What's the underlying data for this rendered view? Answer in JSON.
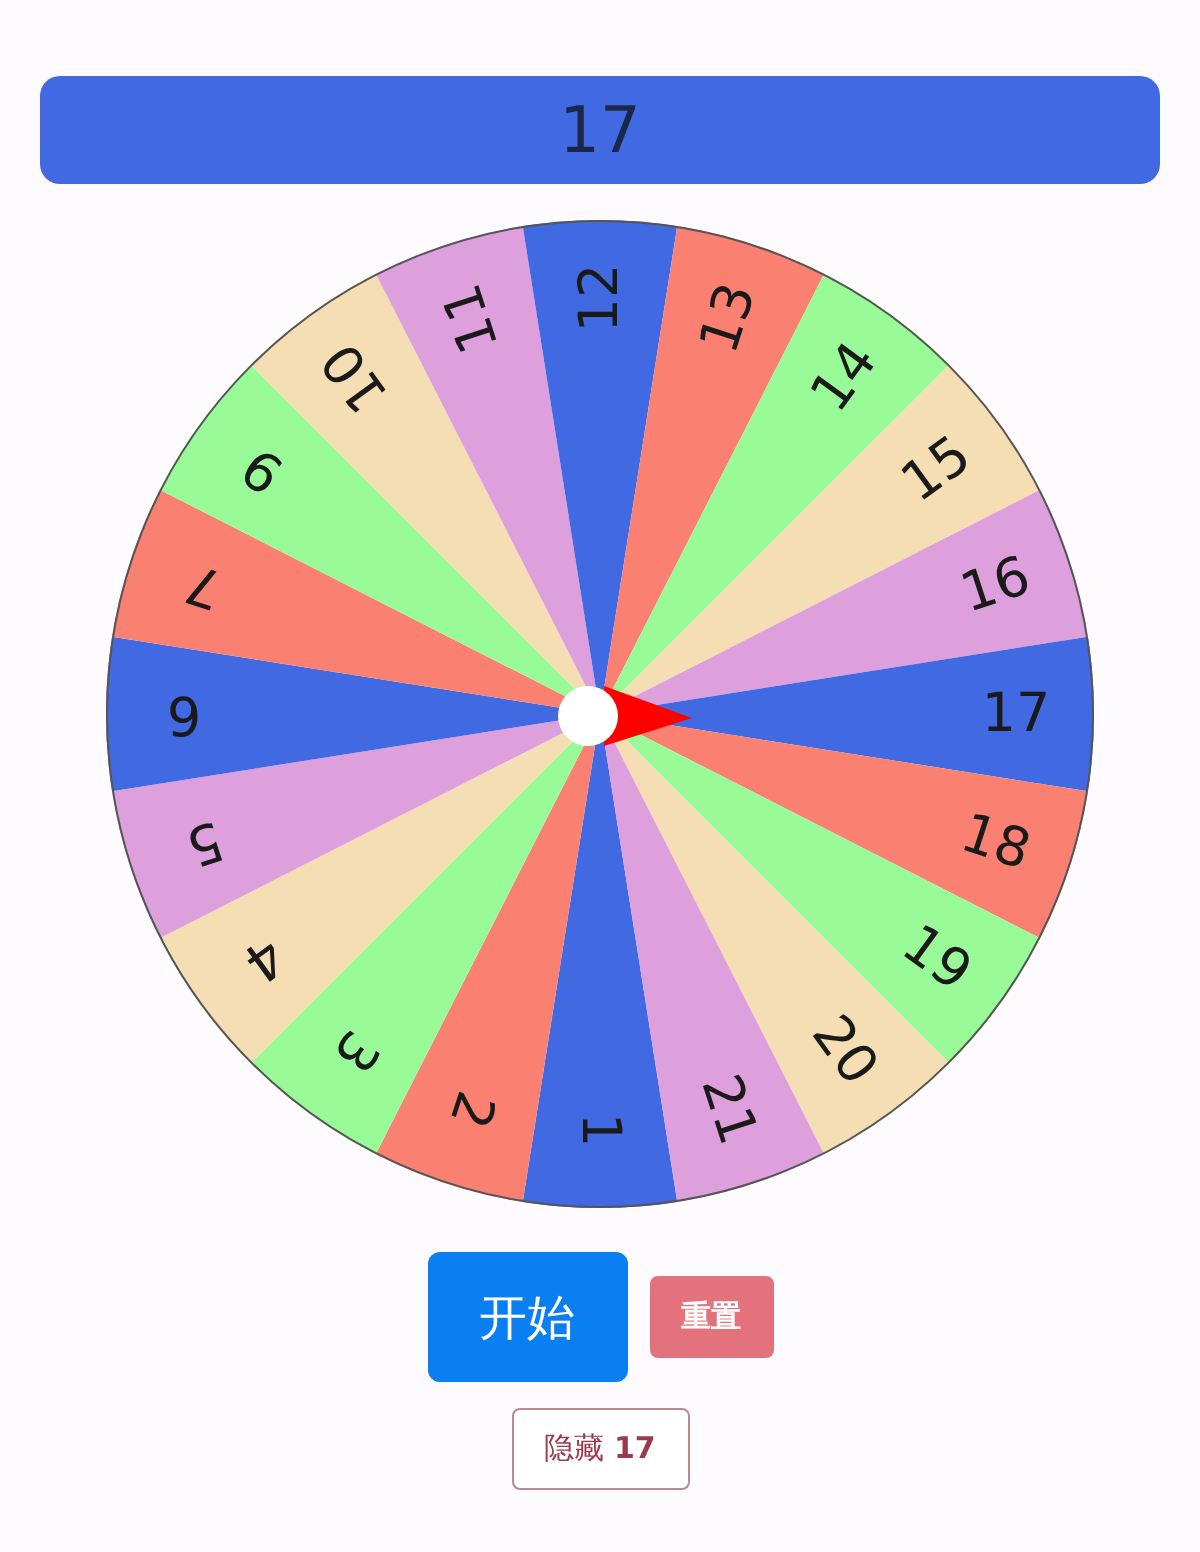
{
  "display": "17",
  "wheel": {
    "segments": [
      {
        "label": "1",
        "color": "#4169e1"
      },
      {
        "label": "2",
        "color": "#fa8072"
      },
      {
        "label": "3",
        "color": "#98fb98"
      },
      {
        "label": "4",
        "color": "#f5deb3"
      },
      {
        "label": "5",
        "color": "#dda0dd"
      },
      {
        "label": "6",
        "color": "#4169e1"
      },
      {
        "label": "7",
        "color": "#fa8072"
      },
      {
        "label": "9",
        "color": "#98fb98"
      },
      {
        "label": "10",
        "color": "#f5deb3"
      },
      {
        "label": "11",
        "color": "#dda0dd"
      },
      {
        "label": "12",
        "color": "#4169e1"
      },
      {
        "label": "13",
        "color": "#fa8072"
      },
      {
        "label": "14",
        "color": "#98fb98"
      },
      {
        "label": "15",
        "color": "#f5deb3"
      },
      {
        "label": "16",
        "color": "#dda0dd"
      },
      {
        "label": "17",
        "color": "#4169e1"
      },
      {
        "label": "18",
        "color": "#fa8072"
      },
      {
        "label": "19",
        "color": "#98fb98"
      },
      {
        "label": "20",
        "color": "#f5deb3"
      },
      {
        "label": "21",
        "color": "#dda0dd"
      }
    ]
  },
  "buttons": [
    {
      "label": "开始",
      "kind": "primary"
    },
    {
      "label": "重置",
      "kind": "danger"
    },
    {
      "label": "隐藏 **17**",
      "kind": "outline"
    }
  ]
}
